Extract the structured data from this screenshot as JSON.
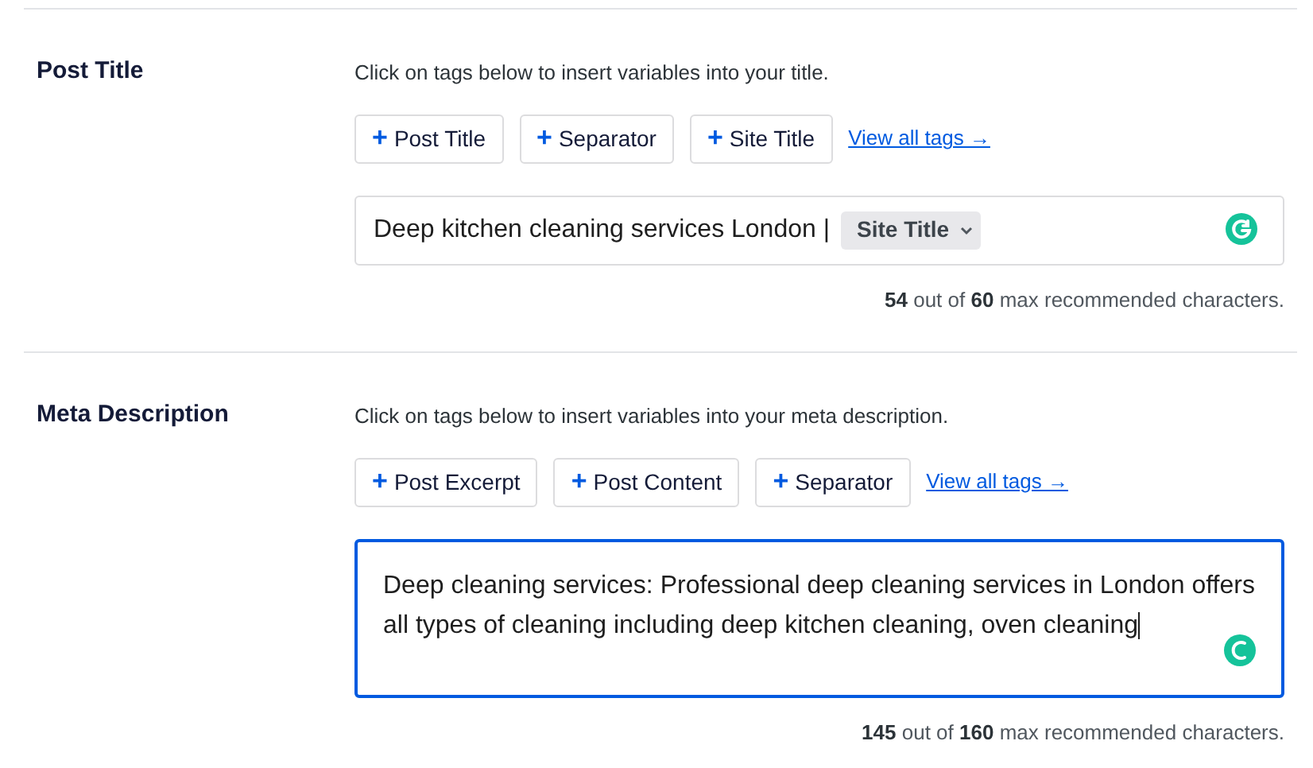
{
  "sections": [
    {
      "label": "Post Title",
      "hint": "Click on tags below to insert variables into your title.",
      "tags": [
        {
          "icon": "+",
          "label": "Post Title"
        },
        {
          "icon": "+",
          "label": "Separator"
        },
        {
          "icon": "+",
          "label": "Site Title"
        }
      ],
      "view_all": "View all tags →",
      "field": {
        "kind": "input",
        "focused": false,
        "parts": [
          {
            "kind": "text",
            "text": "Deep kitchen cleaning services London |"
          },
          {
            "kind": "tag",
            "text": "Site Title"
          }
        ]
      },
      "counter": "**54** out of **60** max recommended characters."
    },
    {
      "label": "Meta Description",
      "hint": "Click on tags below to insert variables into your meta description.",
      "tags": [
        {
          "icon": "+",
          "label": "Post Excerpt"
        },
        {
          "icon": "+",
          "label": "Post Content"
        },
        {
          "icon": "+",
          "label": "Separator"
        }
      ],
      "view_all": "View all tags →",
      "field": {
        "kind": "textarea",
        "focused": true,
        "parts": [
          {
            "kind": "text",
            "text": "Deep cleaning services: Professional deep cleaning services in London offers all types of cleaning including deep kitchen cleaning, oven cleaning"
          }
        ]
      },
      "counter": "**145** out of **160** max recommended characters."
    }
  ]
}
